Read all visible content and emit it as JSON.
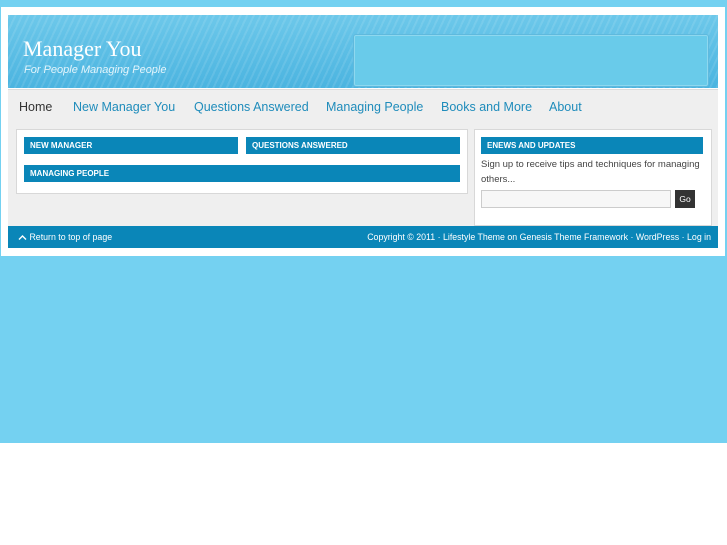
{
  "site": {
    "title": "Manager You",
    "description": "For People Managing People"
  },
  "nav": {
    "items": [
      {
        "label": "Home",
        "current": true
      },
      {
        "label": "New Manager You"
      },
      {
        "label": "Questions Answered"
      },
      {
        "label": "Managing People"
      },
      {
        "label": "Books and More"
      },
      {
        "label": "About"
      }
    ]
  },
  "content": {
    "widgets": [
      {
        "title": "NEW MANAGER"
      },
      {
        "title": "QUESTIONS ANSWERED"
      },
      {
        "title": "MANAGING PEOPLE"
      }
    ]
  },
  "sidebar": {
    "enews": {
      "title": "ENEWS AND UPDATES",
      "text": "Sign up to receive tips and techniques for managing others...",
      "input_value": "",
      "button": "Go"
    }
  },
  "footer": {
    "back_to_top": "Return to top of page",
    "copyright": "Copyright © 2011 ·",
    "theme_link": "Lifestyle Theme",
    "on": "on",
    "framework_link": "Genesis Theme Framework",
    "sep1": "·",
    "wordpress_link": "WordPress",
    "sep2": "·",
    "login_link": "Log in"
  },
  "colors": {
    "page_background": "#74d1f1",
    "accent_blue": "#0a86b8",
    "nav_link": "#1f8cbb"
  },
  "icons": {
    "back_to_top": "chevron-up-icon"
  }
}
